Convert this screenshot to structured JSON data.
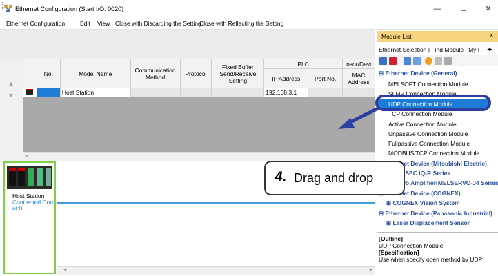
{
  "window": {
    "title": "Ethernet Configuration (Start I/O: 0020)",
    "minimize": "—",
    "maximize": "☐",
    "close": "✕"
  },
  "menu": [
    "Ethernet Configuration",
    "Edit",
    "View",
    "Close with Discarding the Setting",
    "Close with Reflecting the Setting"
  ],
  "table": {
    "headers": {
      "no": "No.",
      "model": "Model Name",
      "comm": "Communication Method",
      "protocol": "Protocol",
      "fixed": "Fixed Buffer Send/Receive Setting",
      "plc": "PLC",
      "ip": "IP Address",
      "port": "Port No.",
      "sensor": "nsor/Devi",
      "mac": "MAC Address"
    },
    "rows": [
      {
        "model": "Host Station",
        "ip": "192.168.3.1"
      }
    ]
  },
  "station": {
    "name": "Host Station",
    "connected": "Connected Cou",
    "count": "nt:0"
  },
  "panel": {
    "title": "Module List",
    "close": "×",
    "tabs": "Ethernet Selection | Find Module | My I",
    "tree": [
      {
        "type": "cat",
        "text": "⊟ Ethernet Device (General)"
      },
      {
        "type": "item",
        "text": "MELSOFT Connection Module"
      },
      {
        "type": "item",
        "text": "SLMP Connection Module"
      },
      {
        "type": "item",
        "text": "UDP Connection Module"
      },
      {
        "type": "item",
        "text": "TCP Connection Module"
      },
      {
        "type": "item",
        "text": "Active Connection Module"
      },
      {
        "type": "item",
        "text": "Unpassive Connection Module"
      },
      {
        "type": "item",
        "text": "Fullpassive Connection Module"
      },
      {
        "type": "item",
        "text": "MODBUS/TCP Connection Module"
      },
      {
        "type": "cat",
        "text": "⊟ Ethernet Device (Mitsubishi Electric)"
      },
      {
        "type": "sub",
        "text": "⊞ MELSEC iQ-R Series"
      },
      {
        "type": "sub",
        "text": "⊞ Servo Amplifier(MELSERVO-J4 Series)"
      },
      {
        "type": "cat",
        "text": "⊟ Ethernet Device (COGNEX)"
      },
      {
        "type": "sub",
        "text": "⊞ COGNEX Vision System"
      },
      {
        "type": "cat",
        "text": "⊟ Ethernet Device (Panasonic Industrial)"
      },
      {
        "type": "sub",
        "text": "⊞ Laser Displacement Sensor"
      }
    ],
    "outline_label": "[Outline]",
    "outline_text": "UDP Connection Module",
    "spec_label": "[Specification]",
    "spec_text": "Use when specify open method by UDP"
  },
  "callout": {
    "step": "4.",
    "text": "Drag and drop"
  },
  "colors": {
    "selection": "#1e7cd6",
    "callout_border": "#2a3f9f",
    "net_line": "#3ea0e0",
    "station_border": "#7fcf4a",
    "panel_header": "#f7d47e"
  }
}
